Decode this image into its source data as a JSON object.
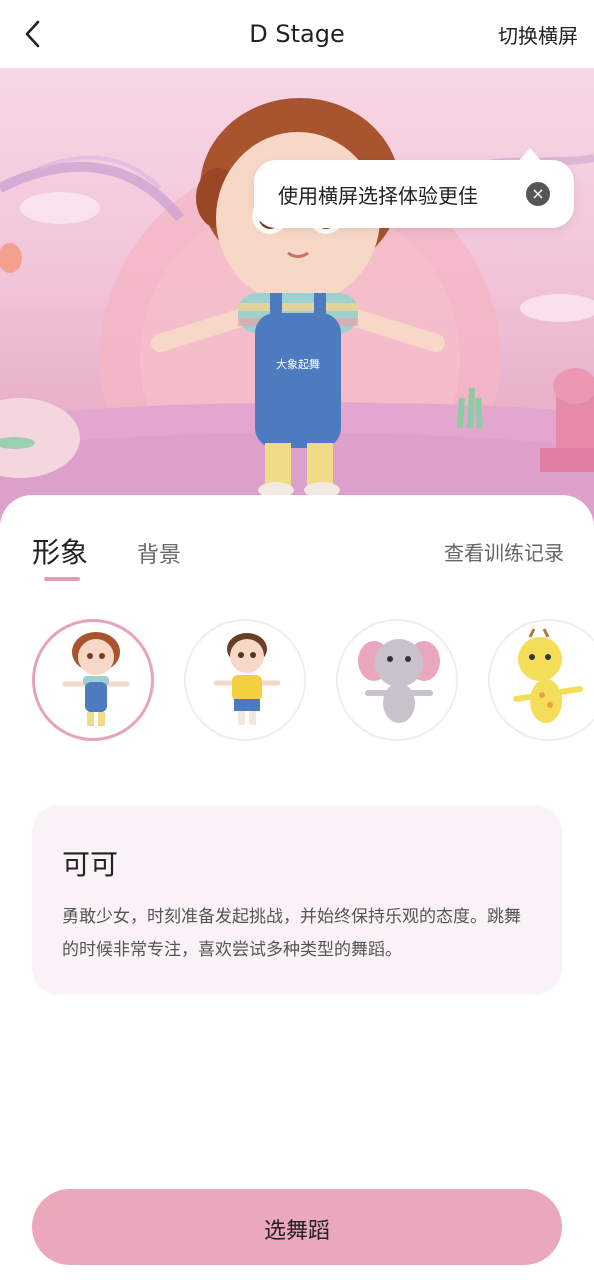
{
  "header": {
    "title": "D Stage",
    "switch_label": "切换横屏",
    "back_icon": "chevron-left-icon"
  },
  "stage": {
    "tooltip_text": "使用横屏选择体验更佳",
    "tooltip_close_icon": "close-icon",
    "character_shirt_text": "大象起舞"
  },
  "tabs": {
    "active": "形象",
    "inactive": "背景",
    "records_link": "查看训练记录"
  },
  "avatars": [
    {
      "name": "girl-avatar",
      "selected": true
    },
    {
      "name": "boy-avatar",
      "selected": false
    },
    {
      "name": "elephant-avatar",
      "selected": false
    },
    {
      "name": "giraffe-avatar",
      "selected": false
    }
  ],
  "info": {
    "name": "可可",
    "description": "勇敢少女，时刻准备发起挑战，并始终保持乐观的态度。跳舞的时候非常专注，喜欢尝试多种类型的舞蹈。"
  },
  "cta": {
    "label": "选舞蹈"
  },
  "colors": {
    "accent": "#e69ab3",
    "button": "#eaa8ba",
    "card": "#faf2f6"
  }
}
